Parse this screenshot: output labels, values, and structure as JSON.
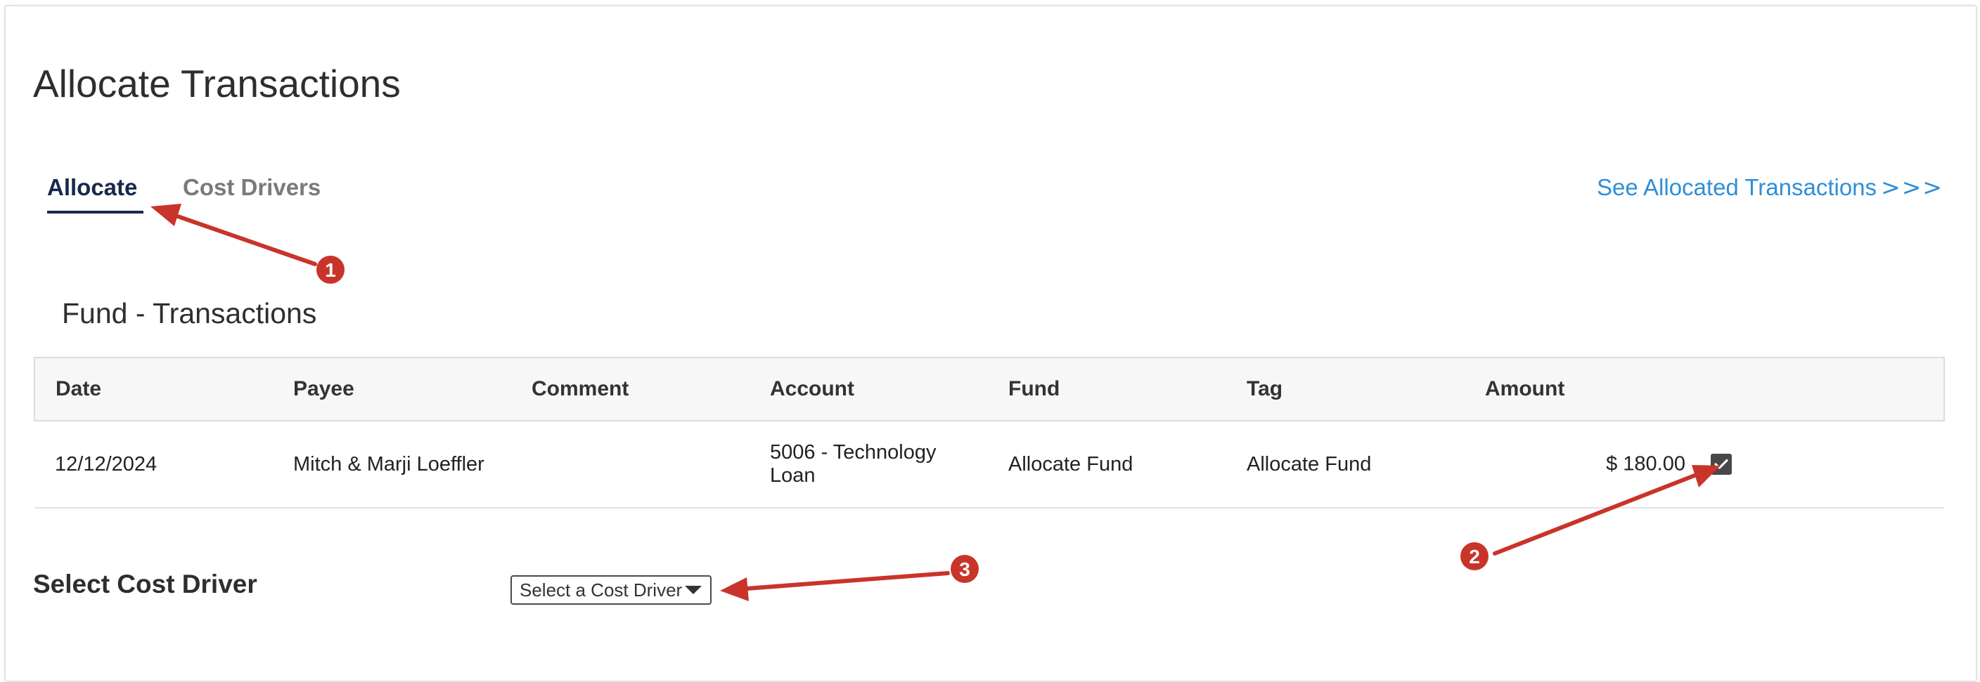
{
  "page": {
    "title": "Allocate Transactions"
  },
  "tabs": [
    {
      "label": "Allocate",
      "active": true
    },
    {
      "label": "Cost Drivers",
      "active": false
    }
  ],
  "see_allocated_link": {
    "label": "See Allocated Transactions",
    "chevrons": ">>>"
  },
  "section": {
    "title": "Fund - Transactions"
  },
  "table": {
    "columns": [
      "Date",
      "Payee",
      "Comment",
      "Account",
      "Fund",
      "Tag",
      "Amount"
    ],
    "rows": [
      {
        "date": "12/12/2024",
        "payee": "Mitch & Marji Loeffler",
        "comment": "",
        "account": "5006 - Technology Loan",
        "fund": "Allocate Fund",
        "tag": "Allocate Fund",
        "amount": "$ 180.00",
        "checked": true
      }
    ]
  },
  "cost_driver": {
    "label": "Select Cost Driver",
    "placeholder": "Select a Cost Driver"
  },
  "annotations": [
    {
      "number": "1",
      "points_to": "tab-allocate"
    },
    {
      "number": "2",
      "points_to": "row-select-checkbox"
    },
    {
      "number": "3",
      "points_to": "cost-driver-select"
    }
  ],
  "colors": {
    "accent_navy": "#16294b",
    "link_blue": "#2f8fd6",
    "annotation_red": "#c9342a",
    "checkbox_fill": "#484848"
  }
}
